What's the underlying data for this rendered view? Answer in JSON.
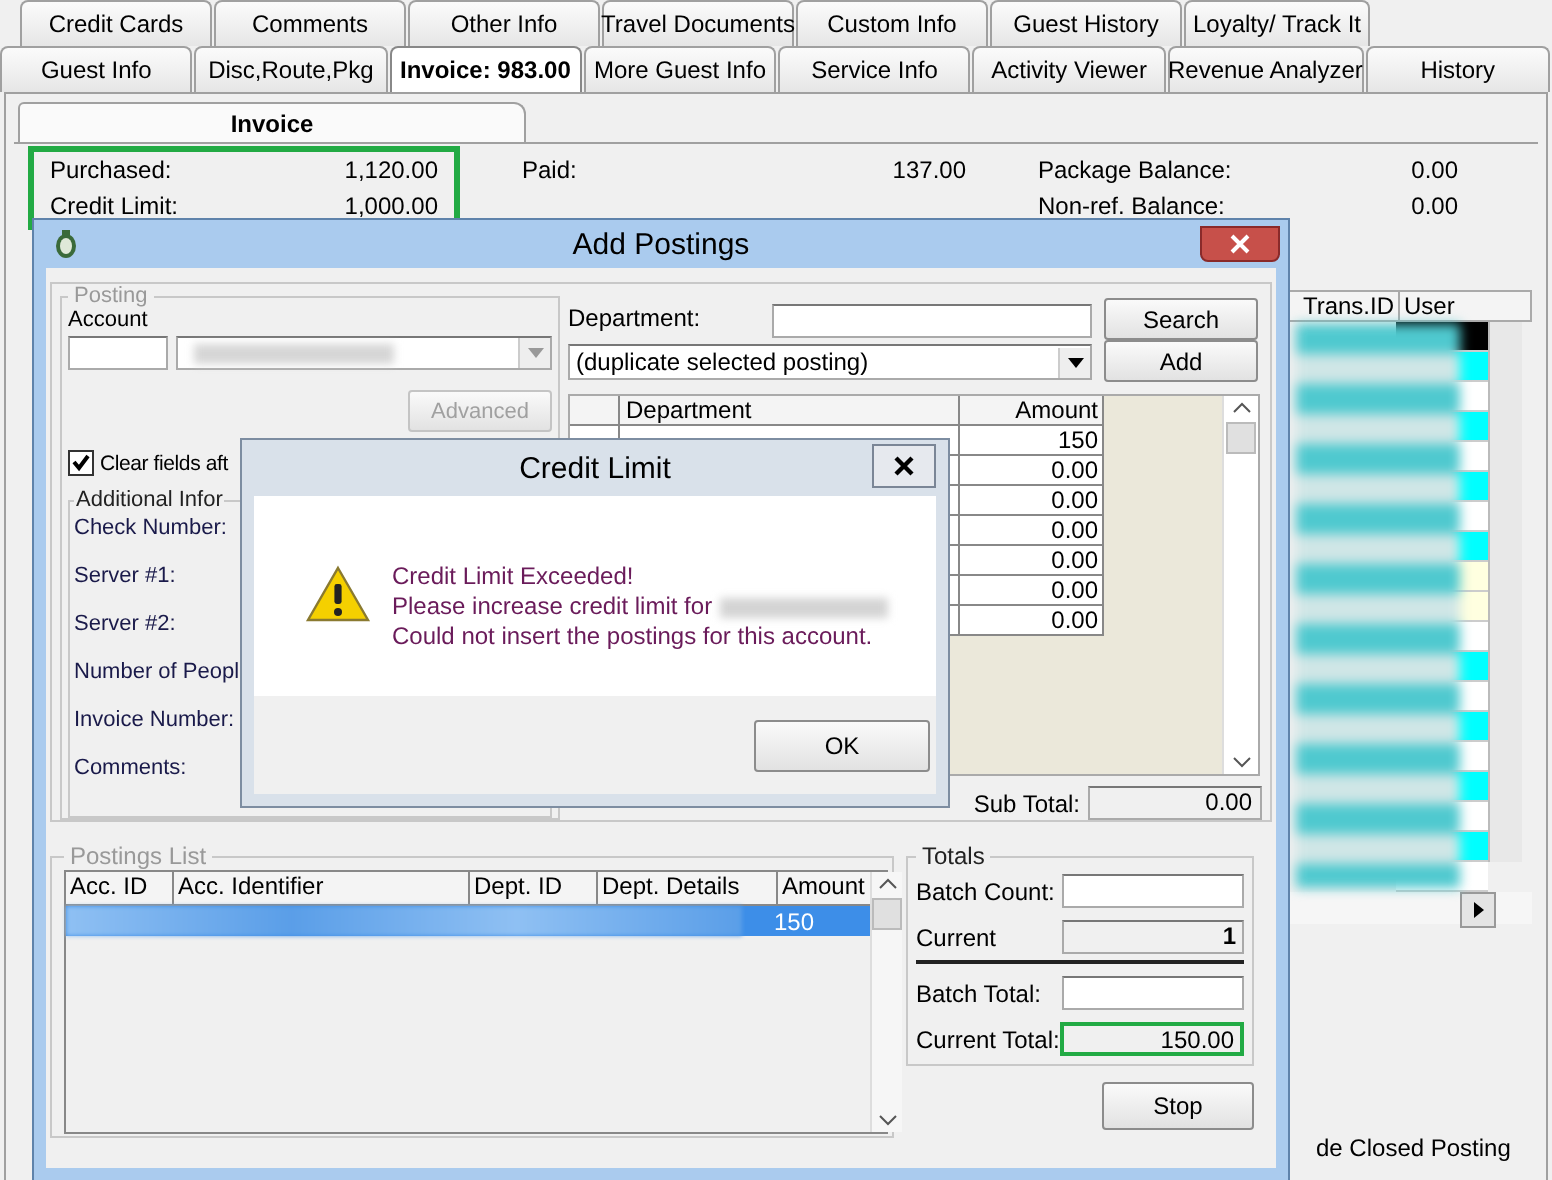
{
  "tabs_row_1": [
    {
      "label": "Credit Cards",
      "selected": false
    },
    {
      "label": "Comments",
      "selected": false
    },
    {
      "label": "Other Info",
      "selected": false
    },
    {
      "label": "Travel Documents",
      "selected": false
    },
    {
      "label": "Custom Info",
      "selected": false
    },
    {
      "label": "Guest History",
      "selected": false
    },
    {
      "label": "Loyalty/ Track It",
      "selected": false
    }
  ],
  "tabs_row_2": [
    {
      "label": "Guest Info",
      "selected": false
    },
    {
      "label": "Disc,Route,Pkg",
      "selected": false
    },
    {
      "label": "Invoice: 983.00",
      "selected": true
    },
    {
      "label": "More Guest Info",
      "selected": false
    },
    {
      "label": "Service Info",
      "selected": false
    },
    {
      "label": "Activity Viewer",
      "selected": false
    },
    {
      "label": "Revenue Analyzer",
      "selected": false
    },
    {
      "label": "History",
      "selected": false
    }
  ],
  "invoice_tab": {
    "label": "Invoice"
  },
  "summary_columns": [
    {
      "highlighted": true,
      "fields": [
        {
          "label": "Purchased:",
          "value": "1,120.00"
        },
        {
          "label": "Credit Limit:",
          "value": "1,000.00"
        }
      ]
    },
    {
      "highlighted": false,
      "fields": [
        {
          "label": "Paid:",
          "value": "137.00"
        }
      ]
    },
    {
      "highlighted": false,
      "fields": [
        {
          "label": "Package Balance:",
          "value": "0.00"
        },
        {
          "label": "Non-ref. Balance:",
          "value": "0.00"
        }
      ]
    }
  ],
  "transactions_table": {
    "columns": [
      "Trans.ID",
      "User"
    ],
    "rows": [
      {
        "color": "#000000"
      },
      {
        "color": "#00ffff"
      },
      {
        "color": "#ffffff"
      },
      {
        "color": "#00ffff"
      },
      {
        "color": "#ffffff"
      },
      {
        "color": "#00ffff"
      },
      {
        "color": "#ffffff"
      },
      {
        "color": "#00ffff"
      },
      {
        "color": "#ffffe0"
      },
      {
        "color": "#ffffe0"
      },
      {
        "color": "#ffffff"
      },
      {
        "color": "#00ffff"
      },
      {
        "color": "#ffffff"
      },
      {
        "color": "#00ffff"
      },
      {
        "color": "#ffffff"
      },
      {
        "color": "#00ffff"
      },
      {
        "color": "#ffffff"
      },
      {
        "color": "#00ffff"
      },
      {
        "color": "#ffffff"
      }
    ]
  },
  "closed_posting_label": "de Closed Posting",
  "add_postings": {
    "title": "Add Postings",
    "posting": {
      "legend": "Posting",
      "account_label": "Account",
      "advanced_button": {
        "label": "Advanced",
        "disabled": true
      },
      "clear_fields": {
        "label": "Clear fields aft",
        "checked": true
      },
      "additional": {
        "legend": "Additional Infor",
        "labels": [
          "Check Number:",
          "Server #1:",
          "Server #2:",
          "Number of Peopl",
          "Invoice Number:",
          "Comments:"
        ]
      }
    },
    "department_label": "Department:",
    "search_button": "Search",
    "add_button": "Add",
    "department_combo": "(duplicate selected posting)",
    "department_grid": {
      "columns": [
        "Department",
        "Amount"
      ],
      "rows": [
        {
          "amount": "150"
        },
        {
          "amount": "0.00"
        },
        {
          "amount": "0.00"
        },
        {
          "amount": "0.00"
        },
        {
          "amount": "0.00"
        },
        {
          "amount": "0.00"
        },
        {
          "amount": "0.00"
        }
      ]
    },
    "sub_total": {
      "label": "Sub Total:",
      "value": "0.00"
    },
    "postings_list": {
      "legend": "Postings List",
      "columns": [
        "Acc. ID",
        "Acc. Identifier",
        "Dept. ID",
        "Dept. Details",
        "Amount"
      ],
      "rows": [
        {
          "amount": "150",
          "selected": true
        }
      ]
    },
    "totals": {
      "legend": "Totals",
      "batch_count_label": "Batch Count:",
      "current_label": "Current",
      "current_value": "1",
      "batch_total_label": "Batch Total:",
      "current_total_label": "Current Total:",
      "current_total_value": "150.00",
      "current_total_highlighted": true
    },
    "stop_button": "Stop"
  },
  "credit_limit": {
    "title": "Credit Limit",
    "lines": [
      "Credit Limit Exceeded!",
      "Please increase credit limit for",
      "Could not insert the postings for this account."
    ],
    "ok_button": "OK"
  }
}
